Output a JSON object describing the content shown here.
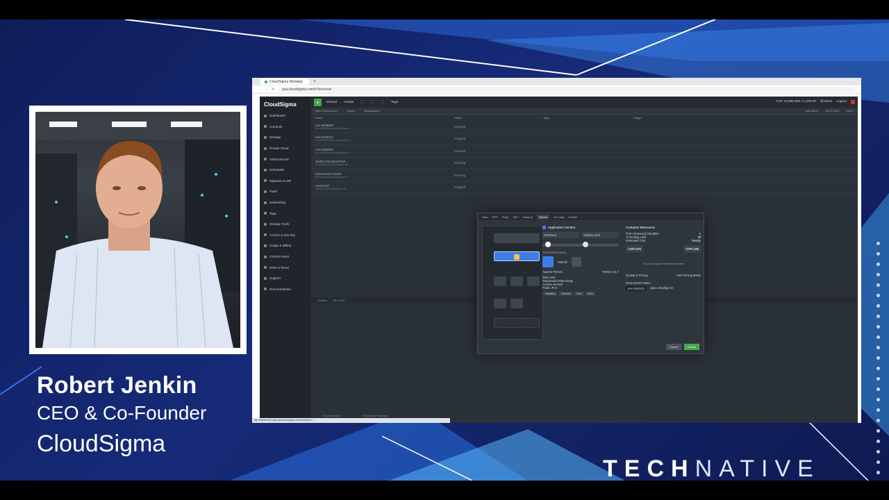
{
  "speaker": {
    "name": "Robert Jenkin",
    "title": "CEO & Co-Founder",
    "company": "CloudSigma"
  },
  "brand": {
    "strong": "TECH",
    "light": "NATIVE"
  },
  "browser": {
    "tab_title": "CloudSigma WebApp",
    "url": "gva.cloudsigma.com/#!/env/new",
    "status_url": "file:///data/unit7.pass.gva.cloudsigma.com/?session=..."
  },
  "app": {
    "logo": "CloudSigma",
    "sidebar": [
      {
        "label": "Dashboard"
      },
      {
        "label": "Compute"
      },
      {
        "label": "Storage"
      },
      {
        "label": "Private Cloud"
      },
      {
        "label": "Virtual Router"
      },
      {
        "label": "Schedules"
      },
      {
        "label": "Migration & DR"
      },
      {
        "label": "PaaS"
      },
      {
        "label": "Networking"
      },
      {
        "label": "Tags"
      },
      {
        "label": "Storage Tools"
      },
      {
        "label": "Access & Security"
      },
      {
        "label": "Usage & Billing"
      },
      {
        "label": "Control Panel"
      },
      {
        "label": "Refer a friend"
      },
      {
        "label": "Support"
      },
      {
        "label": "Documentation"
      }
    ],
    "toolbar": {
      "wizard": "Wizard",
      "create": "Create",
      "tags": "Tags",
      "balance": "CHF 18,996,864 | 1,000.00",
      "user": "@robert",
      "logout": "Logout"
    },
    "subbar": {
      "new_env": "New Environment",
      "import": "Import",
      "marketplace": "Marketplace",
      "balance_label": "BALANCE",
      "settings": "SETTINGS",
      "help": "HELP"
    },
    "env_columns": [
      "Name",
      "Status",
      "Tags",
      "Usage"
    ],
    "environments": [
      {
        "name": "env-4638693",
        "host": "env-4638693.gva.cloudsigma.net",
        "status": "Stopped"
      },
      {
        "name": "env-6129313",
        "host": "env-6129313.gva.cloudsigma.net",
        "status": "Stopped"
      },
      {
        "name": "env-6180900",
        "host": "env-6180900.gva.cloudsigma.net",
        "status": "Stopped"
      },
      {
        "name": "Jenkins DevOps Pack",
        "host": "env-jenkins.gva.cloudsigma.net",
        "status": "Running"
      },
      {
        "name": "Kubernetes Cluster",
        "host": "k8s-cluster.gva.cloudsigma.net",
        "status": "Running"
      },
      {
        "name": "ownCloud",
        "host": "owncloud.gva.cloudsigma.net",
        "status": "Stopped"
      }
    ],
    "bottom_tabs": [
      "Archive",
      "Git / SVN"
    ],
    "footer": [
      "No active tasks",
      "Deployment Manager"
    ]
  },
  "dialog": {
    "tabs": [
      "Java",
      "PHP",
      "Ruby",
      ".NET",
      "Node.js",
      "Python",
      "Go Lang",
      "Docker"
    ],
    "active_tab": "Python",
    "section_title": "Application Servers",
    "reserved_label": "Reserved",
    "scaling_limit_label": "Scaling Limit",
    "horizontal_scaling": "Horizontal Scaling",
    "stateful": "Stateful",
    "server": "Apache Python...",
    "version": "Python 3.6.7",
    "disk_limit": "Disk Limit",
    "sequential_restart": "Sequential restart delay",
    "access_ssl": "Access via SLB",
    "public_ipv4": "Public IPv4",
    "bottom_buttons": [
      "Variables",
      "Volumes",
      "Links",
      "More"
    ],
    "container_resources": "Container Resources",
    "from_reserved": "From Reserved Cloudlets",
    "from_reserved_val": "1",
    "to_scaling": "To Scaling Limit",
    "to_scaling_val": "78",
    "estimated_cost": "Estimated Cost",
    "estimated_cost_val": "hourly",
    "price_from": "CHF0.006",
    "price_to": "CHF0.468",
    "pay_note": "You do not pay for unused resources",
    "quotas": "Quotas & Pricing",
    "how_pricing": "How Pricing Works",
    "env_name_label": "Environment Name",
    "env_name_value": "env-4616101",
    "env_domain": ".gva1.cloudsig.me",
    "cancel": "Cancel",
    "create": "Create"
  },
  "colors": {
    "accent_green": "#47a84d",
    "slide_blue": "#162a78",
    "app_dark": "#2b3138"
  }
}
